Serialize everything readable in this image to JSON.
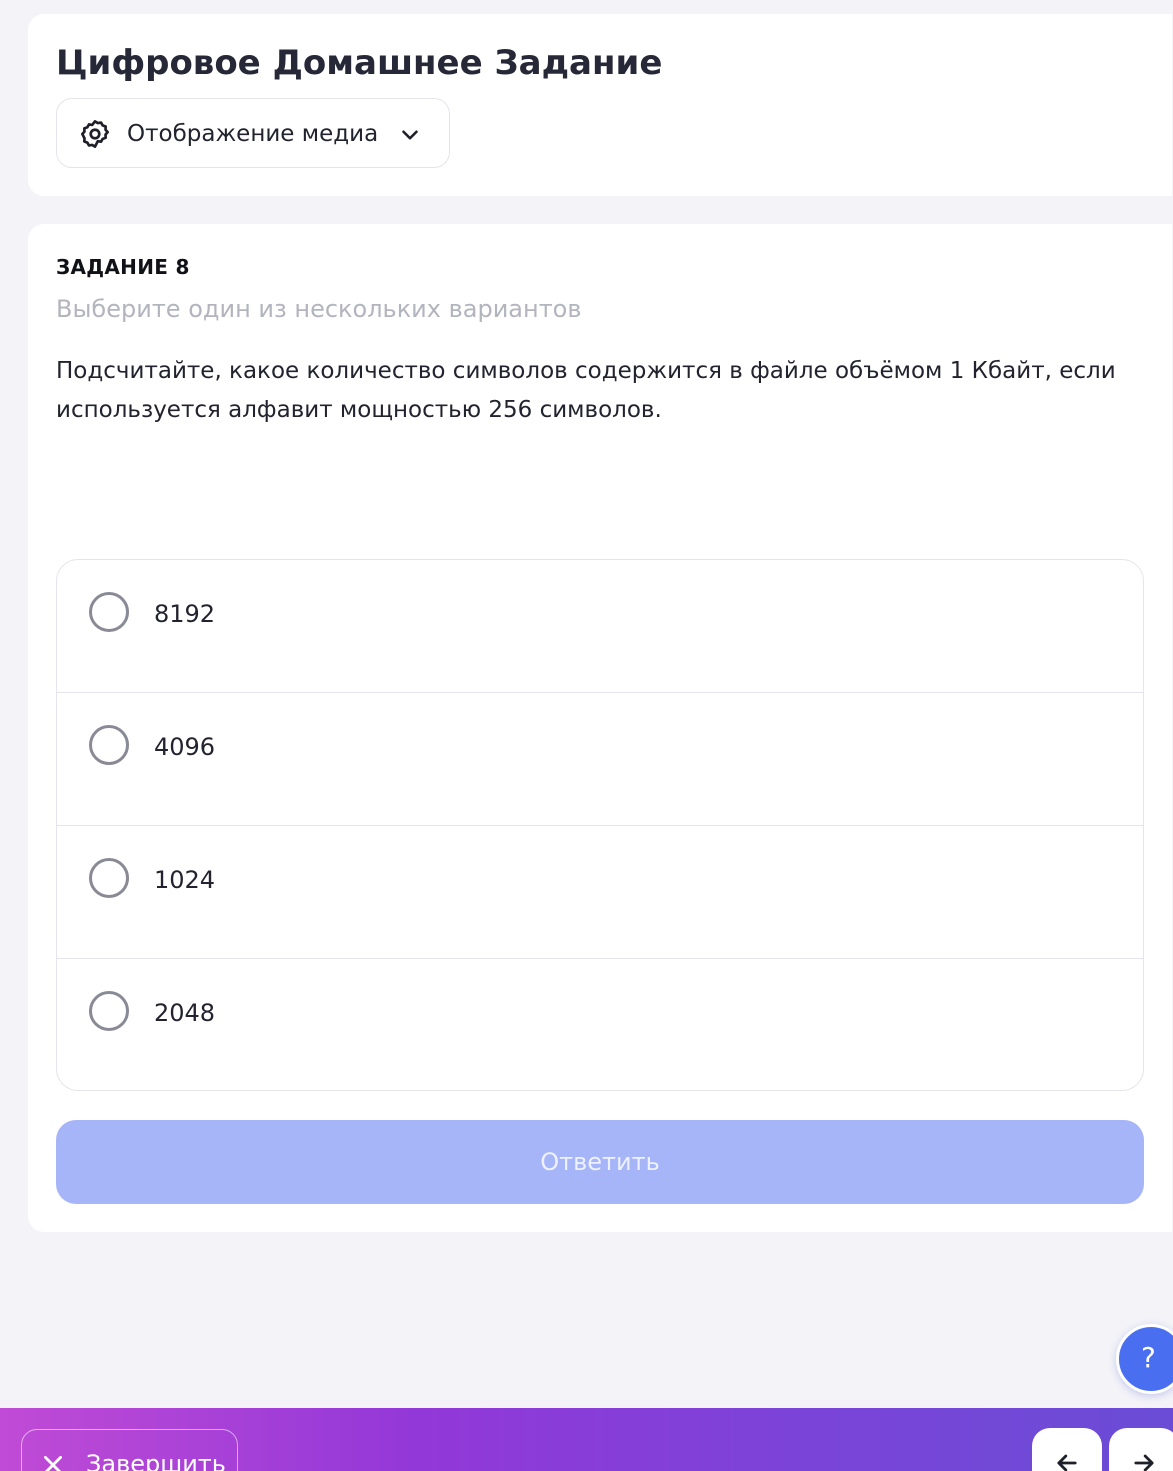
{
  "header": {
    "title": "Цифровое Домашнее Задание",
    "media_dropdown": {
      "label": "Отображение медиа",
      "icon": "gear-icon",
      "chevron": "chevron-down-icon"
    }
  },
  "task": {
    "number_label": "ЗАДАНИЕ 8",
    "hint": "Выберите один из нескольких вариантов",
    "question": "Подсчитайте, какое количество символов содержится в файле объёмом 1 Кбайт, если используется алфавит мощностью 256 символов.",
    "options": [
      {
        "label": "8192",
        "selected": false
      },
      {
        "label": "4096",
        "selected": false
      },
      {
        "label": "1024",
        "selected": false
      },
      {
        "label": "2048",
        "selected": false
      }
    ],
    "answer_button": "Ответить"
  },
  "help_button": "?",
  "bottom_bar": {
    "finish_label": "Завершить",
    "finish_icon": "close-icon",
    "prev_icon": "arrow-left-icon",
    "next_icon": "arrow-right-icon"
  },
  "colors": {
    "page_bg": "#f3f3f8",
    "card_bg": "#ffffff",
    "answer_button_bg": "#a6b5f8",
    "help_button_bg": "#4a6ef0",
    "bar_gradient_start": "#c04bd6",
    "bar_gradient_end": "#6a4cd6"
  }
}
